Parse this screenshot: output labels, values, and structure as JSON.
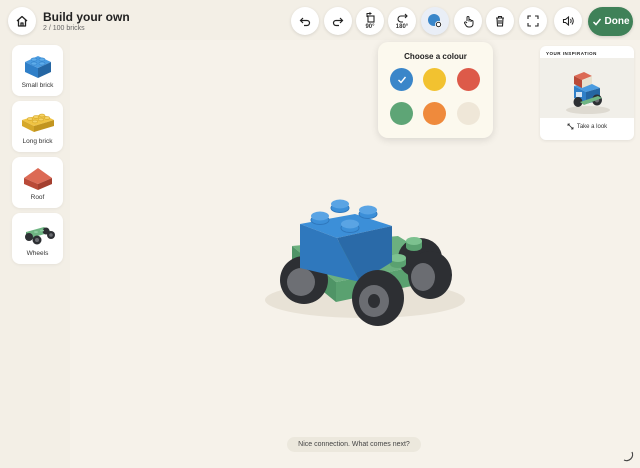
{
  "header": {
    "title": "Build your own",
    "subtitle": "2 / 100 bricks"
  },
  "toolbar": {
    "rotate90_label": "90°",
    "rotate180_label": "180°",
    "done_label": "Done"
  },
  "icons": {
    "home": "home-icon",
    "undo": "undo-icon",
    "redo": "redo-icon",
    "rotate90": "rotate-90-icon",
    "rotate180": "rotate-180-icon",
    "colour": "paint-icon",
    "move": "hand-pointer-icon",
    "delete": "trash-icon",
    "fullscreen": "fullscreen-icon",
    "sound": "speaker-icon",
    "done": "check-icon"
  },
  "bricks": [
    {
      "label": "Small brick",
      "color": "#2f7fc8"
    },
    {
      "label": "Long brick",
      "color": "#e2b532"
    },
    {
      "label": "Roof",
      "color": "#d25843"
    },
    {
      "label": "Wheels",
      "color": "#5fa473"
    }
  ],
  "colour_picker": {
    "title": "Choose a colour",
    "selected_index": 0,
    "swatches": [
      "#3a86c9",
      "#f2c230",
      "#dd5a49",
      "#5ea576",
      "#ef8a3c",
      "#efe7d8"
    ]
  },
  "inspiration": {
    "heading": "YOUR INSPIRATION",
    "action": "Take a look"
  },
  "status": {
    "toast": "Nice connection. What comes next?"
  },
  "colors": {
    "accent": "#3f8158",
    "background": "#f3efe6"
  }
}
